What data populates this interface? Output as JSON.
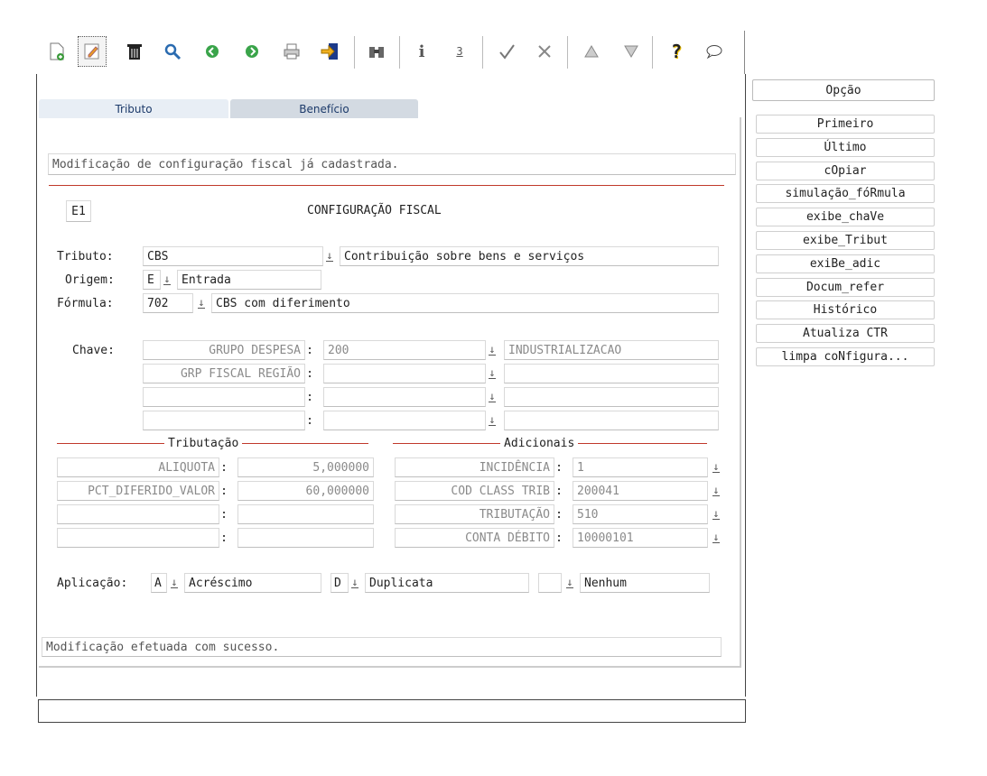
{
  "toolbar": {
    "icons": [
      "new-doc-icon",
      "edit-icon",
      "trash-icon",
      "search-icon",
      "prev-icon",
      "next-icon",
      "print-icon",
      "exit-icon",
      "binoculars-icon",
      "info-icon",
      "counter-icon",
      "check-icon",
      "cancel-icon",
      "up-icon",
      "down-icon",
      "help-icon",
      "comment-icon"
    ]
  },
  "tabs": {
    "tab1": "Tributo",
    "tab2": "Benefício"
  },
  "header_message": "Modificação de configuração fiscal já cadastrada.",
  "code_badge": "E1",
  "section_title": "CONFIGURAÇÃO FISCAL",
  "tributo": {
    "label": "Tributo:",
    "code": "CBS",
    "desc": "Contribuição sobre bens e serviços"
  },
  "origem": {
    "label": "Origem:",
    "code": "E",
    "desc": "Entrada"
  },
  "formula": {
    "label": "Fórmula:",
    "code": "702",
    "desc": "CBS com diferimento"
  },
  "chave": {
    "label": "Chave:",
    "rows": [
      {
        "name": "GRUPO DESPESA",
        "colon": ":",
        "value": "200",
        "desc": "INDUSTRIALIZACAO"
      },
      {
        "name": "GRP FISCAL REGIÃO",
        "colon": ":",
        "value": "",
        "desc": ""
      },
      {
        "name": "",
        "colon": ":",
        "value": "",
        "desc": ""
      },
      {
        "name": "",
        "colon": ":",
        "value": "",
        "desc": ""
      }
    ]
  },
  "tributacao": {
    "title": "Tributação",
    "rows": [
      {
        "name": "ALIQUOTA",
        "colon": ":",
        "value": "5,000000"
      },
      {
        "name": "PCT_DIFERIDO_VALOR",
        "colon": ":",
        "value": "60,000000"
      },
      {
        "name": "",
        "colon": ":",
        "value": ""
      },
      {
        "name": "",
        "colon": ":",
        "value": ""
      }
    ]
  },
  "adicionais": {
    "title": "Adicionais",
    "rows": [
      {
        "name": "INCIDÊNCIA",
        "colon": ":",
        "value": "1"
      },
      {
        "name": "COD CLASS TRIB",
        "colon": ":",
        "value": "200041"
      },
      {
        "name": "TRIBUTAÇÃO",
        "colon": ":",
        "value": "510"
      },
      {
        "name": "CONTA DÉBITO",
        "colon": ":",
        "value": "10000101"
      }
    ]
  },
  "aplicacao": {
    "label": "Aplicação:",
    "f1_code": "A",
    "f1_desc": "Acréscimo",
    "f2_code": "D",
    "f2_desc": "Duplicata",
    "f3_code": "",
    "f3_desc": "Nenhum"
  },
  "footer_message": "Modificação efetuada com sucesso.",
  "status_bar": "",
  "options": {
    "title": "Opção",
    "items": [
      "Primeiro",
      "Último",
      "cOpiar",
      "simulação_fóRmula",
      "exibe_chaVe",
      "exibe_Tribut",
      "exiBe_adic",
      "Docum_refer",
      "Histórico",
      "Atualiza CTR",
      "limpa coNfigura..."
    ]
  },
  "colors": {
    "accent_line": "#c0392b",
    "tab_active": "#e8eef5",
    "tab_inactive": "#d3dae2"
  }
}
